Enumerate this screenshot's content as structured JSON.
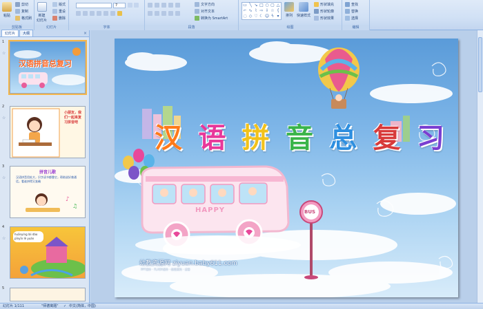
{
  "ribbon": {
    "clipboard": {
      "paste": "粘贴",
      "cut": "剪切",
      "copy": "复制",
      "format_painter": "格式刷",
      "label": "剪贴板"
    },
    "slides": {
      "new_slide": "新建",
      "new_slide_2": "幻灯片",
      "layout": "版式",
      "reset": "重设",
      "delete": "删除",
      "label": "幻灯片"
    },
    "font": {
      "label": "字体",
      "size_value": "7"
    },
    "paragraph": {
      "text_direction": "文字方向",
      "align_text": "对齐文本",
      "smartart": "转换为 SmartArt",
      "label": "段落"
    },
    "drawing": {
      "arrange": "排列",
      "quick_styles": "快速样式",
      "shape_fill": "形状填充",
      "shape_outline": "形状轮廓",
      "shape_effects": "形状效果",
      "label": "绘图"
    },
    "editing": {
      "find": "查找",
      "replace": "替换",
      "select": "选择",
      "label": "编辑"
    }
  },
  "leftpane": {
    "tab_slides": "幻灯片",
    "tab_outline": "大纲",
    "close": "×",
    "thumbs": [
      {
        "num": "1",
        "title": "汉语拼音总复习"
      },
      {
        "num": "2",
        "heading": "小朋友，我们一起来复习拼音吧"
      },
      {
        "num": "3",
        "heading": "拼音儿歌",
        "body": "汉语拼音用处大，识字读书都靠它，帮助说好普通话，看谁拼得又准确"
      },
      {
        "num": "4",
        "bubble": "huānyíng lái dào pīnyīn lè yuán"
      },
      {
        "num": "5"
      }
    ]
  },
  "slide": {
    "title_chars": [
      "汉",
      "语",
      "拼",
      "音",
      "总",
      "复",
      "习"
    ],
    "title_colors": [
      "#ff7a1a",
      "#e8389a",
      "#f2c21a",
      "#3ab44a",
      "#2e8fe0",
      "#d83a3a",
      "#7a3fd1"
    ],
    "bus_label": "HAPPY",
    "sign_label": "BUS",
    "caption": "幼教资源网 ziyuan.baby611.com",
    "subcaption": "PPT课件 · FLASH课件 · 教案资料 · 试卷"
  },
  "statusbar": {
    "slide_info": "幻灯片 1/111",
    "theme": "\"师德离题\"",
    "language": "中文(简体，中国)"
  },
  "colors": {
    "ribbon_bg": "#d1e1f5",
    "accent": "#15428b",
    "selected_thumb": "#f4b64a"
  }
}
